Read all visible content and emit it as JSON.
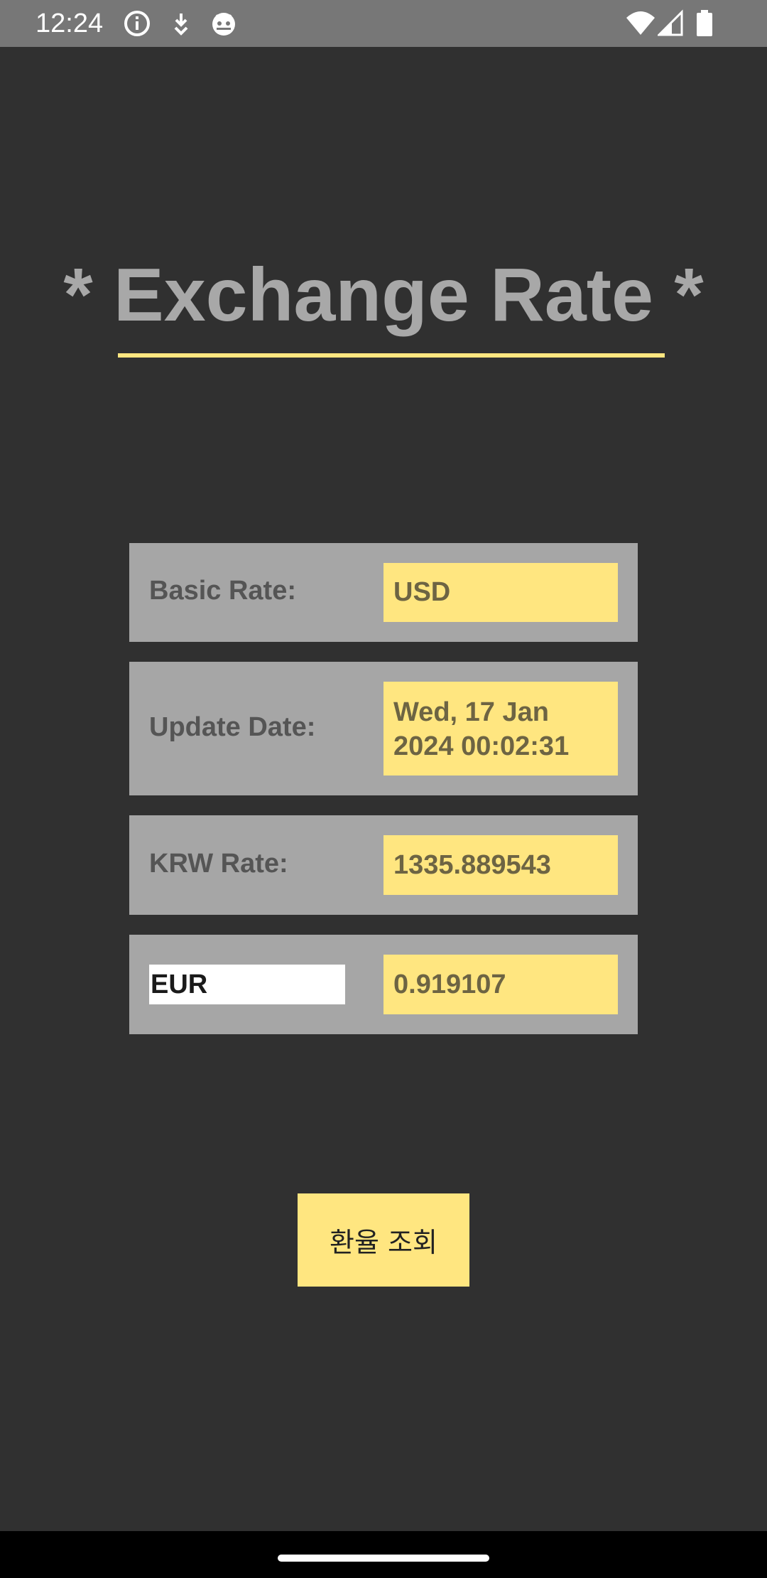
{
  "status_bar": {
    "time": "12:24",
    "icons_left": [
      "info-icon",
      "download-icon",
      "android-icon"
    ],
    "icons_right": [
      "wifi-icon",
      "signal-icon",
      "battery-icon"
    ]
  },
  "title": "* Exchange Rate *",
  "rows": [
    {
      "label": "Basic Rate:",
      "value": "USD"
    },
    {
      "label": "Update Date:",
      "value_line1": "Wed, 17 Jan",
      "value_line2": "2024 00:02:31"
    },
    {
      "label": "KRW Rate:",
      "value": "1335.889543"
    },
    {
      "input_value": "EUR",
      "value": "0.919107"
    }
  ],
  "button": {
    "label": "환율 조회"
  },
  "colors": {
    "background": "#303030",
    "status_bar": "#777777",
    "row_background": "#a6a6a6",
    "accent_yellow": "#ffe680",
    "title_text": "#a8a8a8",
    "label_text": "#555555",
    "value_text": "#6d6443"
  }
}
